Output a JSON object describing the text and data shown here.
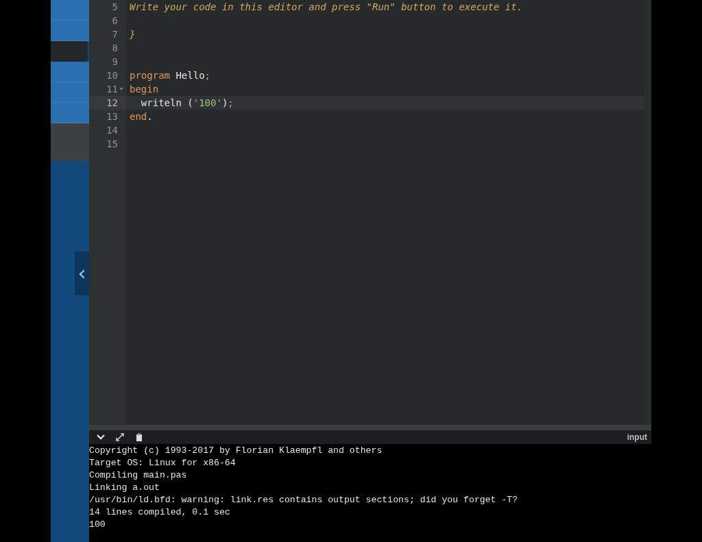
{
  "sidebar": {
    "items": [
      {
        "selected": false
      },
      {
        "selected": false
      },
      {
        "selected": true
      },
      {
        "selected": false
      },
      {
        "selected": false
      },
      {
        "selected": false
      }
    ],
    "collapse_button": {
      "label": "‹"
    }
  },
  "editor": {
    "lines": [
      {
        "number": "5",
        "active": false,
        "tokens": [
          {
            "kind": "comment",
            "text": "Write your code in this editor and press \"Run\" button to execute it."
          }
        ]
      },
      {
        "number": "6",
        "active": false
      },
      {
        "number": "7",
        "active": false,
        "tokens": [
          {
            "kind": "comment",
            "text": "}"
          }
        ]
      },
      {
        "number": "8",
        "active": false
      },
      {
        "number": "9",
        "active": false
      },
      {
        "number": "10",
        "active": false,
        "tokens": [
          {
            "kind": "keyword",
            "text": "program"
          },
          {
            "kind": "plain",
            "text": " Hello"
          },
          {
            "kind": "punct",
            "text": ";"
          }
        ]
      },
      {
        "number": "11",
        "active": false,
        "fold": true,
        "tokens": [
          {
            "kind": "keyword",
            "text": "begin"
          }
        ]
      },
      {
        "number": "12",
        "active": true,
        "tokens": [
          {
            "kind": "plain",
            "text": "  writeln ("
          },
          {
            "kind": "string",
            "text": "'100'"
          },
          {
            "kind": "plain",
            "text": ")"
          },
          {
            "kind": "punct",
            "text": ";"
          }
        ]
      },
      {
        "number": "13",
        "active": false,
        "tokens": [
          {
            "kind": "keyword",
            "text": "end"
          },
          {
            "kind": "plain",
            "text": "."
          }
        ]
      },
      {
        "number": "14",
        "active": false
      },
      {
        "number": "15",
        "active": false
      }
    ]
  },
  "output_panel": {
    "input_label": "input",
    "lines": [
      "Copyright (c) 1993-2017 by Florian Klaempfl and others",
      "Target OS: Linux for x86-64",
      "Compiling main.pas",
      "Linking a.out",
      "/usr/bin/ld.bfd: warning: link.res contains output sections; did you forget -T?",
      "14 lines compiled, 0.1 sec",
      "100"
    ]
  }
}
